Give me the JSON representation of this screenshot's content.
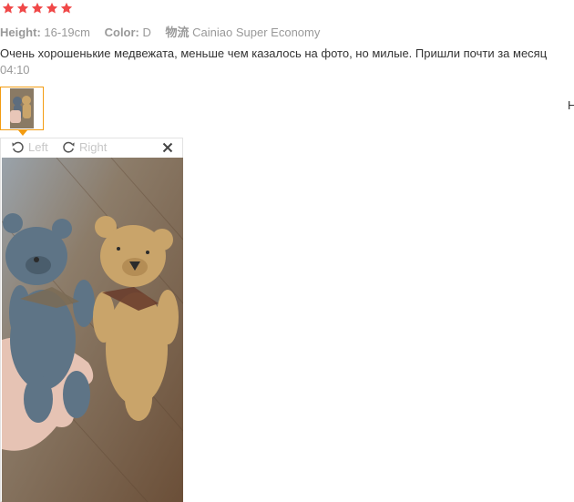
{
  "rating": {
    "stars": 5,
    "max": 5,
    "color": "#f04848"
  },
  "attributes": {
    "height_key": "Height:",
    "height_value": "16-19cm",
    "color_key": "Color:",
    "color_value": "D",
    "shipping_key": "物流",
    "shipping_value": "Cainiao Super Economy"
  },
  "review": {
    "text": "Очень хорошенькие медвежата, меньше чем казалось на фото, но милые. Пришли почти за месяц",
    "time": "04:10"
  },
  "gallery": {
    "accent": "#f39c12",
    "edge_char": "Н"
  },
  "viewer": {
    "rotate_left_label": "Left",
    "rotate_right_label": "Right",
    "close_icon": "close-icon"
  }
}
